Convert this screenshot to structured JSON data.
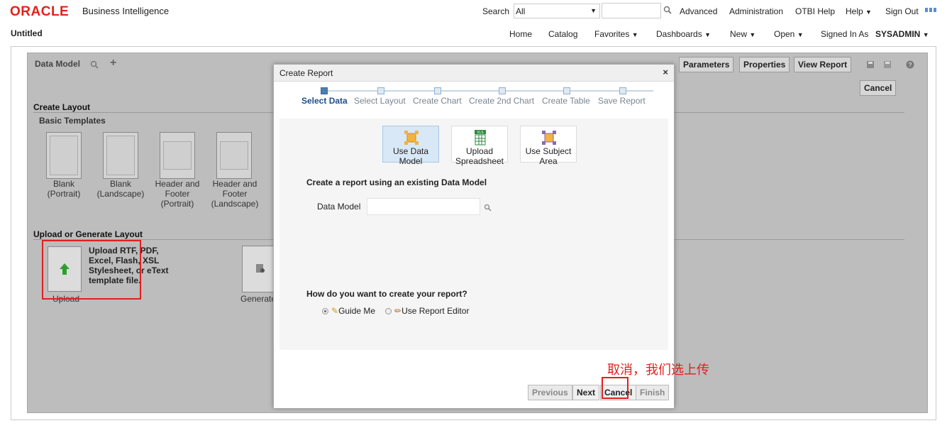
{
  "header": {
    "logo": "ORACLE",
    "product": "Business Intelligence",
    "search_label": "Search",
    "search_scope": "All",
    "links": [
      "Advanced",
      "Administration",
      "OTBI Help",
      "Help",
      "Sign Out"
    ]
  },
  "nav": {
    "page_title": "Untitled",
    "items": [
      "Home",
      "Catalog",
      "Favorites",
      "Dashboards",
      "New",
      "Open"
    ],
    "signed_in_label": "Signed In As",
    "user": "SYSADMIN"
  },
  "editor": {
    "toolbar_title": "Data Model",
    "parameters_btn": "Parameters",
    "properties_btn": "Properties",
    "view_report_btn": "View Report",
    "cancel_btn": "Cancel",
    "create_layout": "Create Layout",
    "basic_templates": "Basic Templates",
    "templates": [
      "Blank (Portrait)",
      "Blank (Landscape)",
      "Header and Footer (Portrait)",
      "Header and Footer (Landscape)"
    ],
    "upload_section": "Upload or Generate Layout",
    "upload_label": "Upload",
    "upload_desc": "Upload RTF, PDF, Excel, Flash, XSL Stylesheet, or eText template file.",
    "generate_label": "Generate"
  },
  "dialog": {
    "title": "Create Report",
    "steps": [
      "Select Data",
      "Select Layout",
      "Create Chart",
      "Create 2nd Chart",
      "Create Table",
      "Save Report"
    ],
    "active_step": 0,
    "sources": [
      "Use Data Model",
      "Upload Spreadsheet",
      "Use Subject Area"
    ],
    "selected_source": 0,
    "xls_badge": "XLS",
    "prompt": "Create a report using an existing Data Model",
    "data_model_label": "Data Model",
    "data_model_value": "",
    "question": "How do you want to create your report?",
    "options": [
      "Guide Me",
      "Use Report Editor"
    ],
    "selected_option": 0,
    "buttons": {
      "previous": "Previous",
      "next": "Next",
      "cancel": "Cancel",
      "finish": "Finish"
    }
  },
  "annotation": "取消，我们选上传",
  "colors": {
    "oracle_red": "#e2231a",
    "annotation_red": "#e02020",
    "selected_blue": "#d9e8f6"
  }
}
